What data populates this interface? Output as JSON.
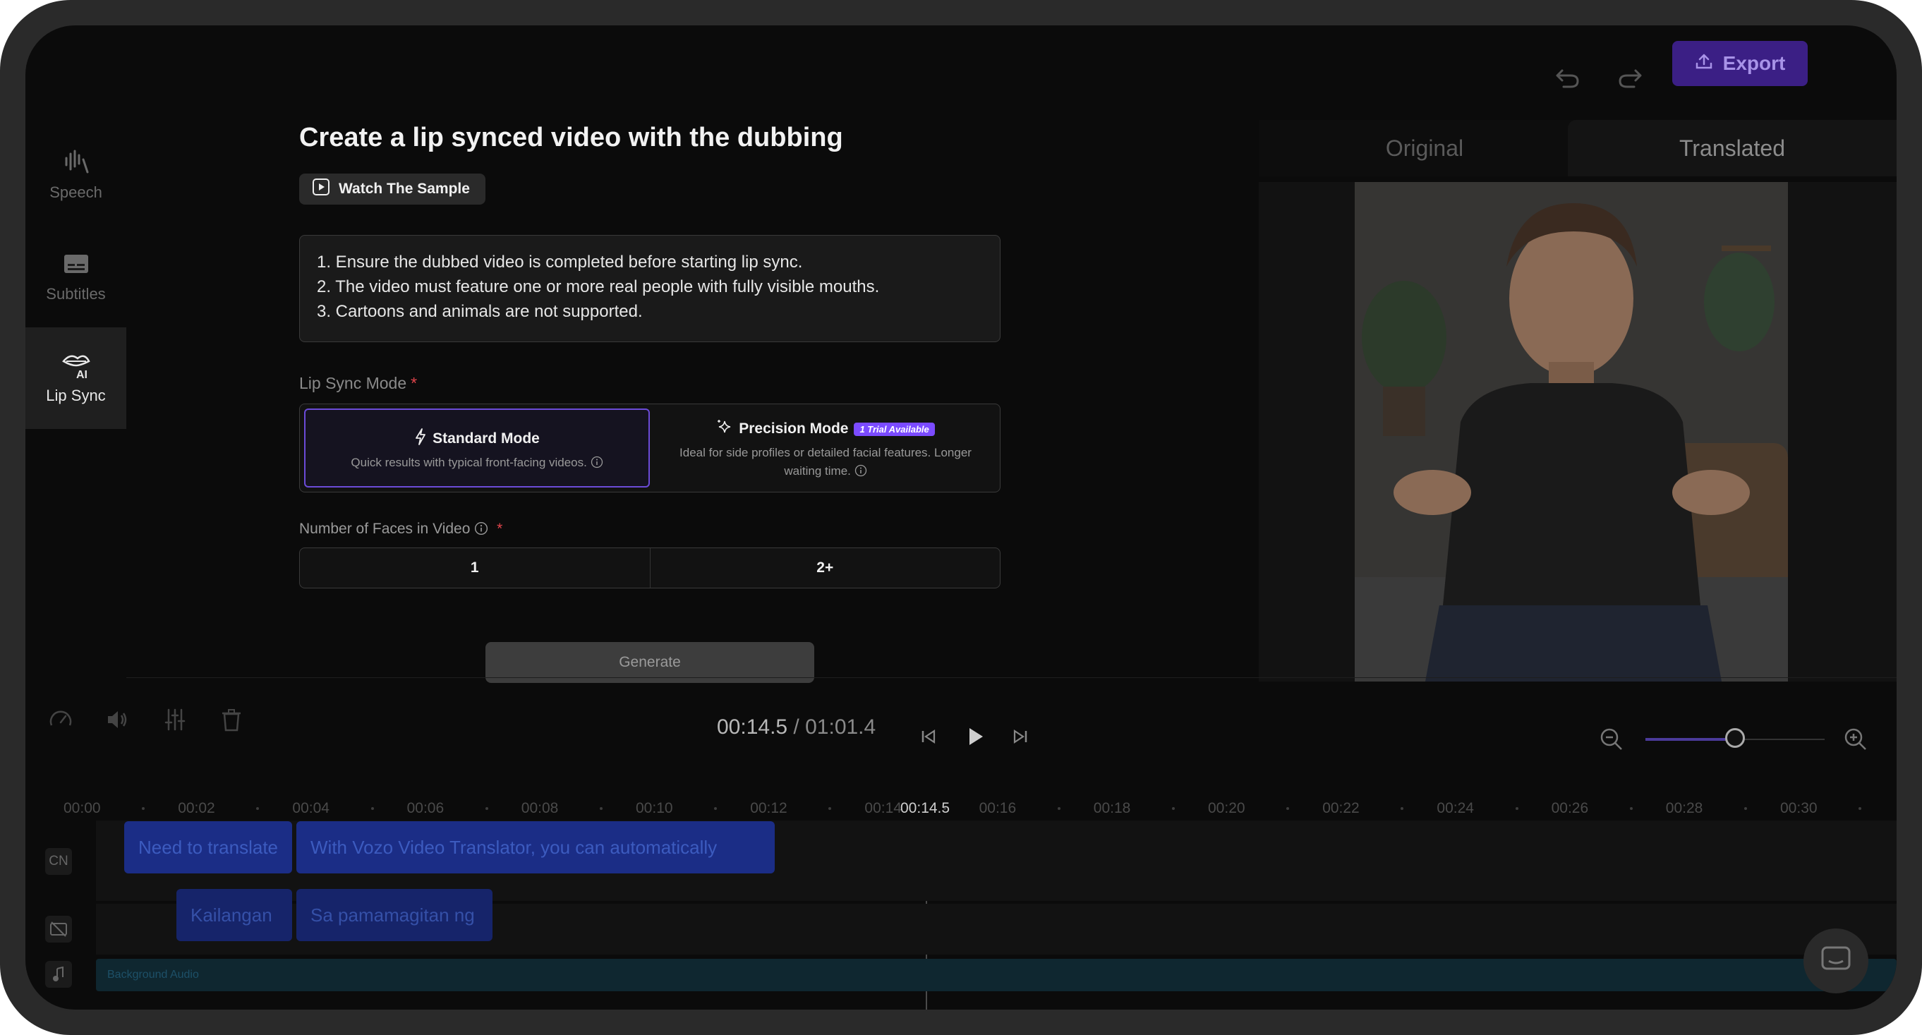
{
  "sidebar": {
    "items": [
      {
        "label": "Speech",
        "icon": "waveform-icon"
      },
      {
        "label": "Subtitles",
        "icon": "subtitles-icon"
      },
      {
        "label": "Lip Sync",
        "icon": "ai-lips-icon",
        "active": true
      }
    ]
  },
  "panel": {
    "title": "Create a lip synced video with the dubbing",
    "sample_button": "Watch The Sample",
    "notes": [
      "1. Ensure the dubbed video is completed before starting lip sync.",
      "2. The video must feature one or more real people with fully visible mouths.",
      "3. Cartoons and animals are not supported."
    ],
    "mode_label": "Lip Sync Mode",
    "required_mark": "*",
    "modes": {
      "standard": {
        "title": "Standard Mode",
        "desc": "Quick results with typical front-facing videos."
      },
      "precision": {
        "title": "Precision Mode",
        "badge": "1 Trial Available",
        "desc1": "Ideal for side profiles or detailed facial features. Longer",
        "desc2": "waiting time."
      }
    },
    "faces_label": "Number of Faces in Video",
    "faces_options": [
      "1",
      "2+"
    ],
    "generate": "Generate"
  },
  "header": {
    "export": "Export"
  },
  "preview": {
    "tabs": [
      "Original",
      "Translated"
    ],
    "active_tab": "Translated"
  },
  "playback": {
    "current": "00:14.5",
    "separator": " / ",
    "total": "01:01.4",
    "zoom_level": 0.5
  },
  "ruler": {
    "labels": [
      "00:00",
      "00:02",
      "00:04",
      "00:06",
      "00:08",
      "00:10",
      "00:12",
      "00:14",
      "00:16",
      "00:18",
      "00:20",
      "00:22",
      "00:24",
      "00:26",
      "00:28",
      "00:30"
    ],
    "playhead": "00:14.5"
  },
  "tracks": {
    "cn_tag": "CN",
    "cn_clips": [
      "Need to translate",
      "With Vozo Video Translator, you can automatically"
    ],
    "tl_clips": [
      "Kailangan",
      "Sa pamamagitan ng"
    ],
    "audio": "Background Audio"
  },
  "colors": {
    "accent": "#6b4bd8",
    "export_bg": "#3b1f85",
    "badge": "#7b4bff",
    "clip": "#1b2d86",
    "required": "#e0444b"
  }
}
